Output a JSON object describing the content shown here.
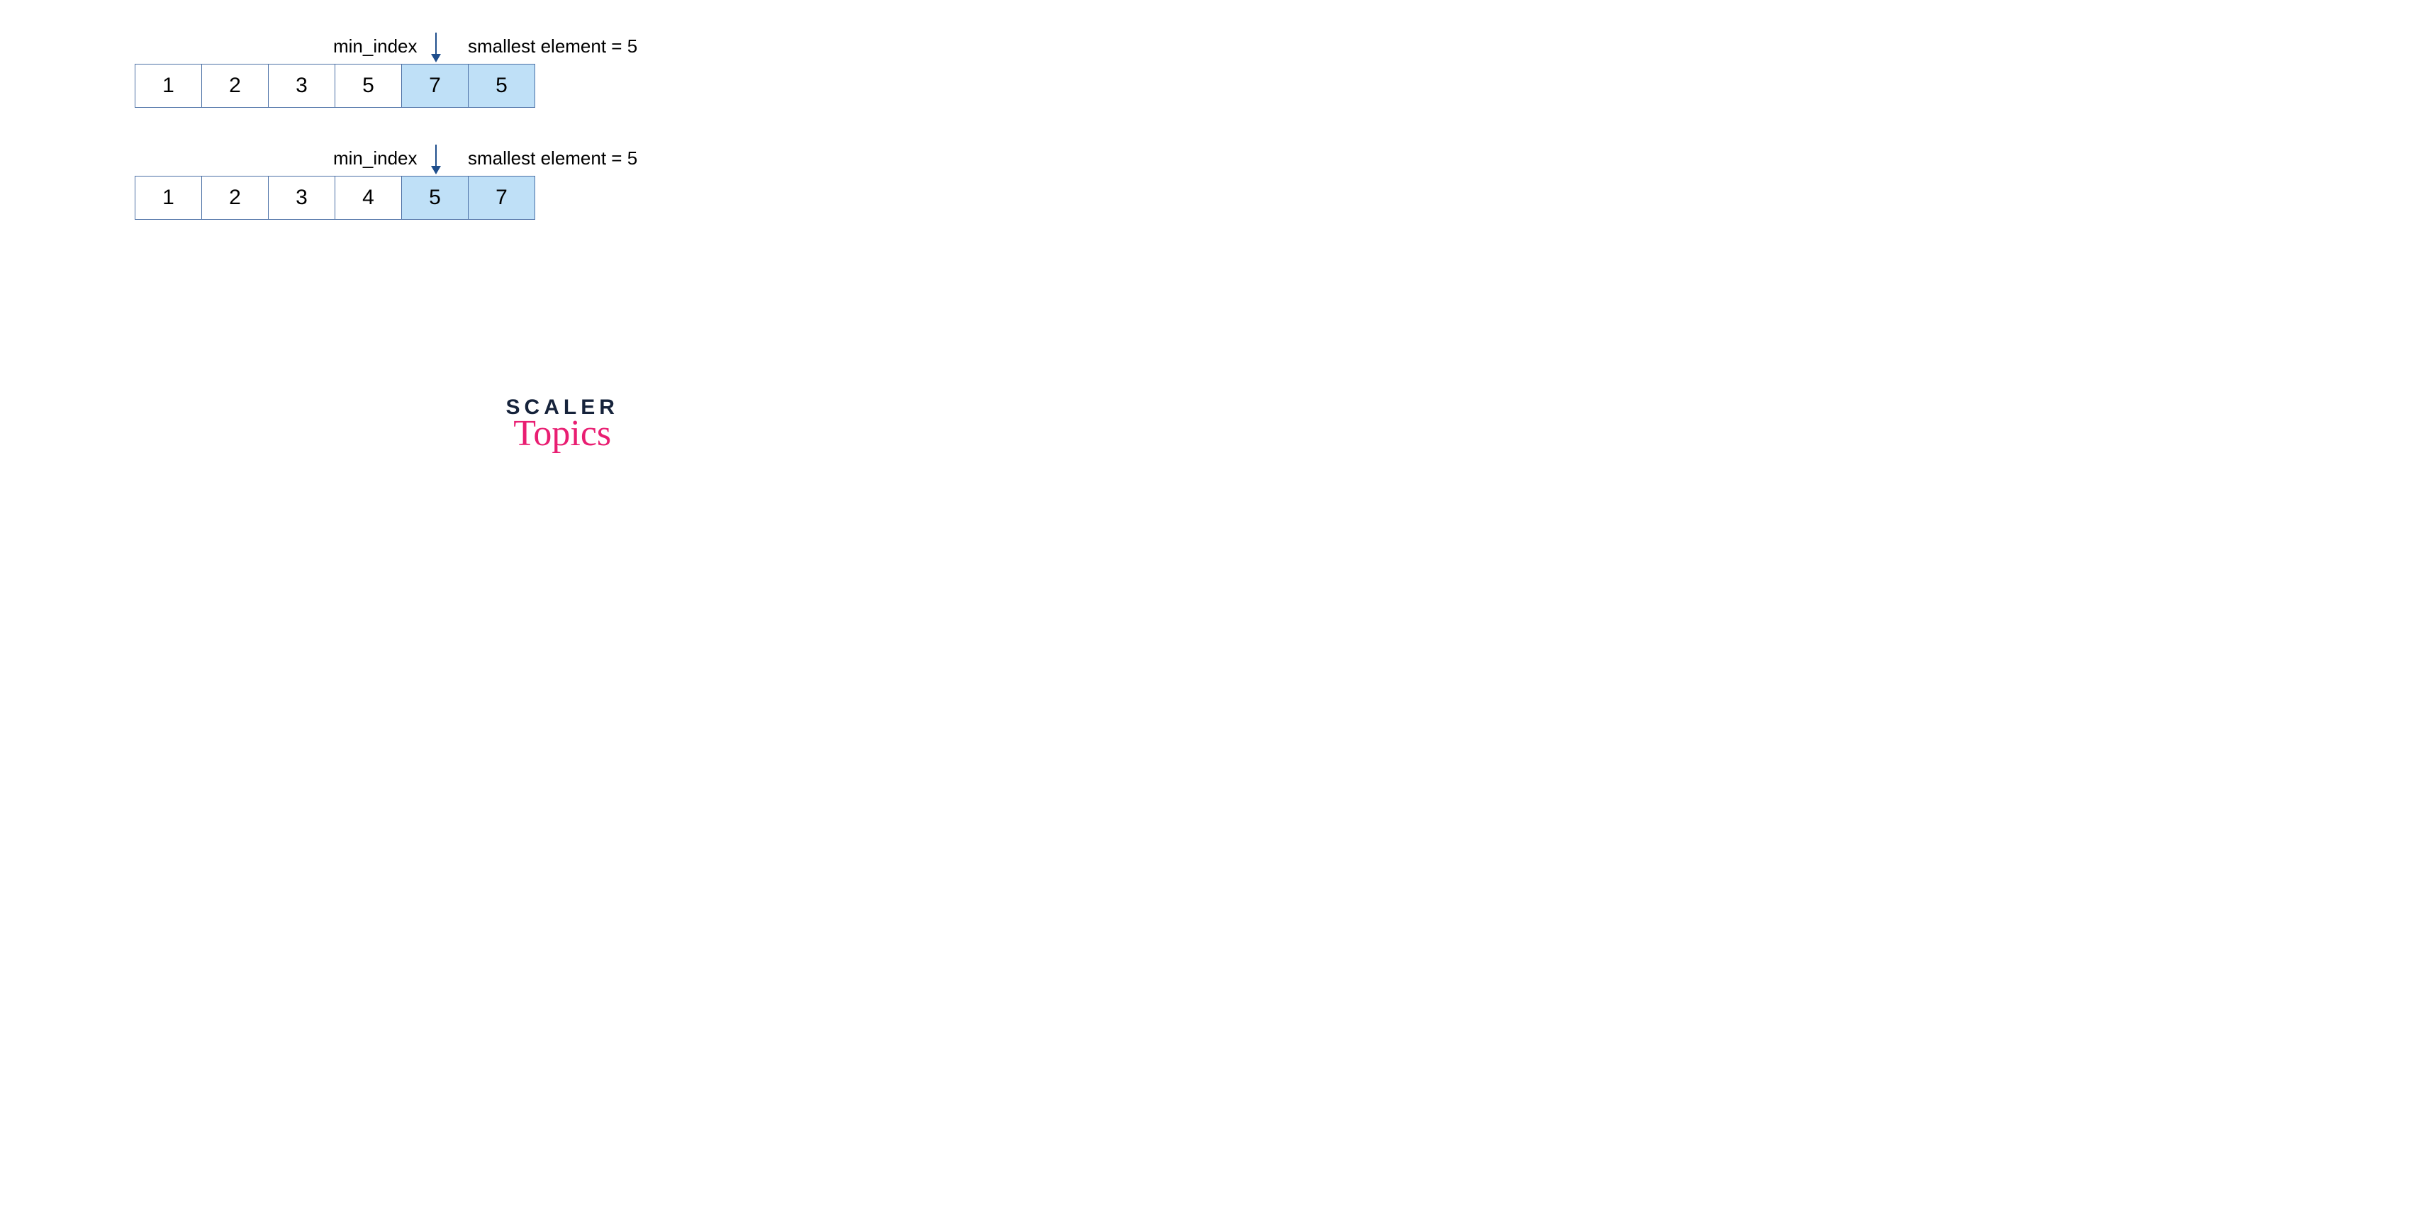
{
  "rows": [
    {
      "min_index_label": "min_index",
      "smallest_label": "smallest element = 5",
      "arrow_cell": 4,
      "cells": [
        {
          "value": "1",
          "highlight": false
        },
        {
          "value": "2",
          "highlight": false
        },
        {
          "value": "3",
          "highlight": false
        },
        {
          "value": "5",
          "highlight": false
        },
        {
          "value": "7",
          "highlight": true
        },
        {
          "value": "5",
          "highlight": true
        }
      ]
    },
    {
      "min_index_label": "min_index",
      "smallest_label": "smallest element = 5",
      "arrow_cell": 4,
      "cells": [
        {
          "value": "1",
          "highlight": false
        },
        {
          "value": "2",
          "highlight": false
        },
        {
          "value": "3",
          "highlight": false
        },
        {
          "value": "4",
          "highlight": false
        },
        {
          "value": "5",
          "highlight": true
        },
        {
          "value": "7",
          "highlight": true
        }
      ]
    }
  ],
  "logo": {
    "line1": "SCALER",
    "line2": "Topics"
  },
  "colors": {
    "cell_border": "#4a6fa5",
    "highlight_bg": "#bfe0f7",
    "arrow": "#1f4e8c",
    "logo_dark": "#16233b",
    "logo_pink": "#e91e72"
  }
}
